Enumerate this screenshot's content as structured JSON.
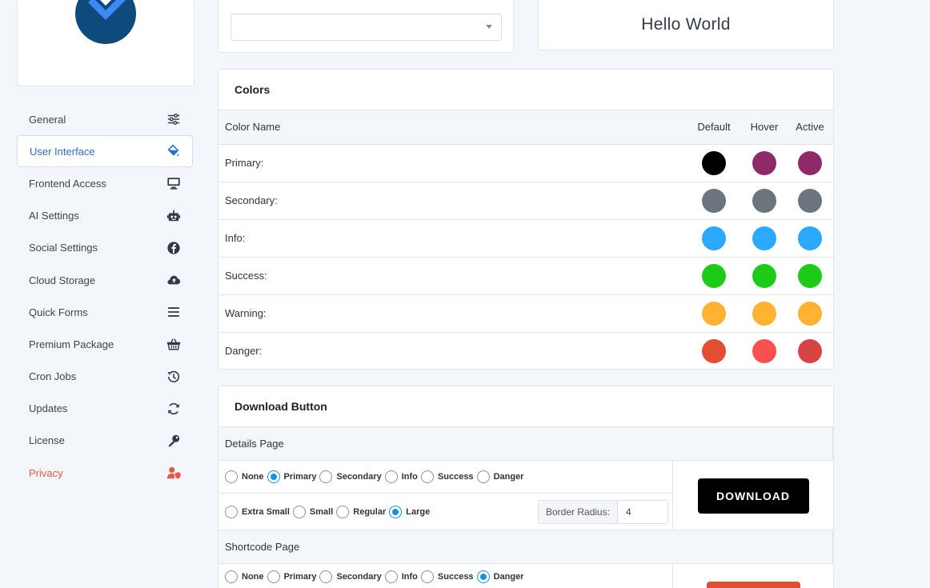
{
  "nav": [
    {
      "label": "General",
      "icon": "sliders-icon",
      "state": "normal"
    },
    {
      "label": "User Interface",
      "icon": "paint-bucket-icon",
      "state": "active"
    },
    {
      "label": "Frontend Access",
      "icon": "monitor-icon",
      "state": "normal"
    },
    {
      "label": "AI Settings",
      "icon": "robot-icon",
      "state": "normal"
    },
    {
      "label": "Social Settings",
      "icon": "facebook-icon",
      "state": "normal"
    },
    {
      "label": "Cloud Storage",
      "icon": "cloud-upload-icon",
      "state": "normal"
    },
    {
      "label": "Quick Forms",
      "icon": "bars-icon",
      "state": "normal"
    },
    {
      "label": "Premium Package",
      "icon": "basket-icon",
      "state": "normal"
    },
    {
      "label": "Cron Jobs",
      "icon": "history-icon",
      "state": "normal"
    },
    {
      "label": "Updates",
      "icon": "sync-icon",
      "state": "normal"
    },
    {
      "label": "License",
      "icon": "key-icon",
      "state": "normal"
    },
    {
      "label": "Privacy",
      "icon": "user-shield-icon",
      "state": "danger"
    }
  ],
  "top": {
    "select_value": "",
    "hello_text": "Hello World"
  },
  "colors": {
    "title": "Colors",
    "headers": {
      "name": "Color Name",
      "default": "Default",
      "hover": "Hover",
      "active": "Active"
    },
    "rows": [
      {
        "label": "Primary:",
        "default": "#000000",
        "hover": "#8e2a6a",
        "active": "#8e2a6a"
      },
      {
        "label": "Secondary:",
        "default": "#6c757d",
        "hover": "#6c757d",
        "active": "#6c757d"
      },
      {
        "label": "Info:",
        "default": "#2ba8ff",
        "hover": "#2ba8ff",
        "active": "#2ba8ff"
      },
      {
        "label": "Success:",
        "default": "#1ccb17",
        "hover": "#1ccb17",
        "active": "#1ccb17"
      },
      {
        "label": "Warning:",
        "default": "#ffb132",
        "hover": "#ffb132",
        "active": "#ffb132"
      },
      {
        "label": "Danger:",
        "default": "#e14e32",
        "hover": "#fb5050",
        "active": "#d84444"
      }
    ]
  },
  "download": {
    "title": "Download Button",
    "details": {
      "section_label": "Details Page",
      "style_options": [
        {
          "label": "None",
          "checked": false
        },
        {
          "label": "Primary",
          "checked": true
        },
        {
          "label": "Secondary",
          "checked": false
        },
        {
          "label": "Info",
          "checked": false
        },
        {
          "label": "Success",
          "checked": false
        },
        {
          "label": "Danger",
          "checked": false
        }
      ],
      "size_options": [
        {
          "label": "Extra Small",
          "checked": false
        },
        {
          "label": "Small",
          "checked": false
        },
        {
          "label": "Regular",
          "checked": false
        },
        {
          "label": "Large",
          "checked": true
        }
      ],
      "border_radius_label": "Border Radius:",
      "border_radius_value": "4",
      "preview_label": "DOWNLOAD",
      "preview_color": "#000000"
    },
    "shortcode": {
      "section_label": "Shortcode Page",
      "style_options": [
        {
          "label": "None",
          "checked": false
        },
        {
          "label": "Primary",
          "checked": false
        },
        {
          "label": "Secondary",
          "checked": false
        },
        {
          "label": "Info",
          "checked": false
        },
        {
          "label": "Success",
          "checked": false
        },
        {
          "label": "Danger",
          "checked": true
        }
      ],
      "preview_color": "#e14e32"
    }
  }
}
